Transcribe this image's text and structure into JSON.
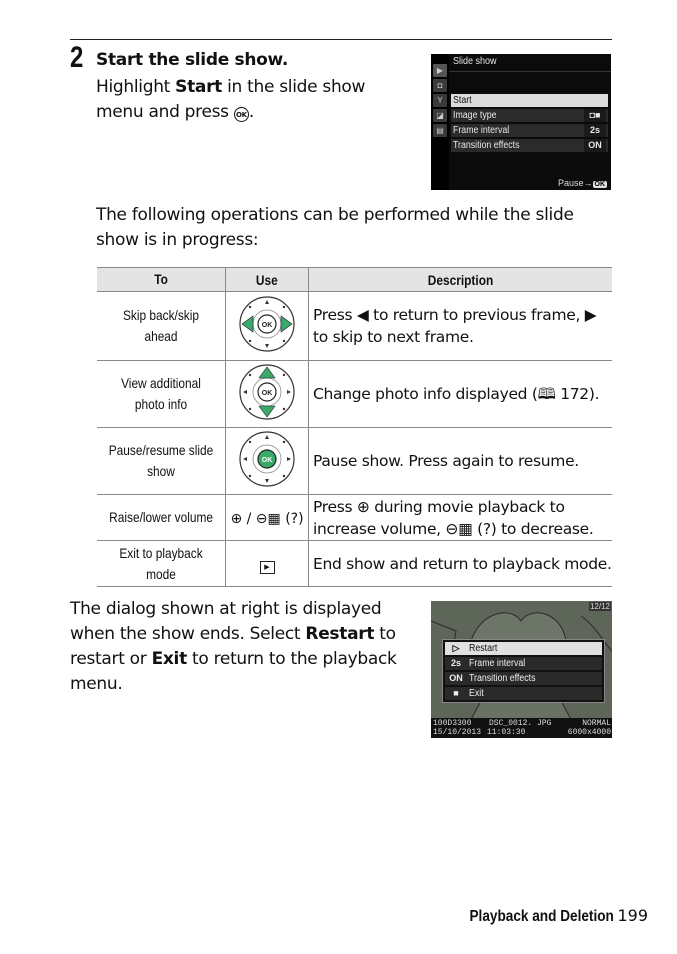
{
  "step": {
    "number": "2",
    "title": "Start the slide show.",
    "body_before": "Highlight ",
    "body_bold": "Start",
    "body_after": " in the slide show menu and press ",
    "ok_symbol": "OK",
    "body_end": "."
  },
  "slideshow_menu": {
    "title": "Slide show",
    "tabs": [
      "playback-icon",
      "camera-icon",
      "wrench-icon",
      "retouch-icon",
      "recent-icon"
    ],
    "items": [
      {
        "label": "Start",
        "value": "",
        "selected": true
      },
      {
        "label": "Image type",
        "value": "◘■",
        "selected": false
      },
      {
        "label": "Frame interval",
        "value": "2s",
        "selected": false
      },
      {
        "label": "Transition effects",
        "value": "ON",
        "selected": false
      }
    ],
    "footer_label": "Pause→",
    "footer_ok": "OK"
  },
  "ops_intro": "The following operations can be performed while the slide show is in progress:",
  "table": {
    "headers": [
      "To",
      "Use",
      "Description"
    ],
    "rows": [
      {
        "to": "Skip back/skip ahead",
        "use": "multi-selector-left-right",
        "description": "Press ◀ to return to previous frame, ▶ to skip to next frame."
      },
      {
        "to": "View additional photo info",
        "use": "multi-selector-up-down",
        "description": "Change photo info displayed (🕮 172)."
      },
      {
        "to": "Pause/resume slide show",
        "use": "ok-button",
        "description": "Pause show.  Press again to resume."
      },
      {
        "to": "Raise/lower volume",
        "use_text": "⊕ / ⊖▦ (?)",
        "description": "Press ⊕ during movie playback to increase volume, ⊖▦ (?) to decrease."
      },
      {
        "to": "Exit to playback mode",
        "use_text": "▶",
        "description": "End show and return to playback mode."
      }
    ]
  },
  "end_text": {
    "part1": "The dialog shown at right is displayed when the show ends.  Select ",
    "bold1": "Restart",
    "part2": " to restart or ",
    "bold2": "Exit",
    "part3": " to return to the playback menu."
  },
  "end_dialog": {
    "counter": "12/12",
    "items": [
      {
        "icon": "▷",
        "label": "Restart",
        "selected": true
      },
      {
        "icon": "2s",
        "label": "Frame interval",
        "selected": false
      },
      {
        "icon": "ON",
        "label": "Transition effects",
        "selected": false
      },
      {
        "icon": "■",
        "label": "Exit",
        "selected": false
      }
    ],
    "info": {
      "folder": "100D3300",
      "filename": "DSC_0012. JPG",
      "quality": "NORMAL",
      "date": "15/10/2013",
      "time": "11:03:30",
      "size": "6000x4000"
    }
  },
  "footer": {
    "section": "Playback and Deletion",
    "page": "199"
  },
  "colors": {
    "accent_green": "#3aaa6a",
    "table_header_bg": "#e4e4e4"
  }
}
